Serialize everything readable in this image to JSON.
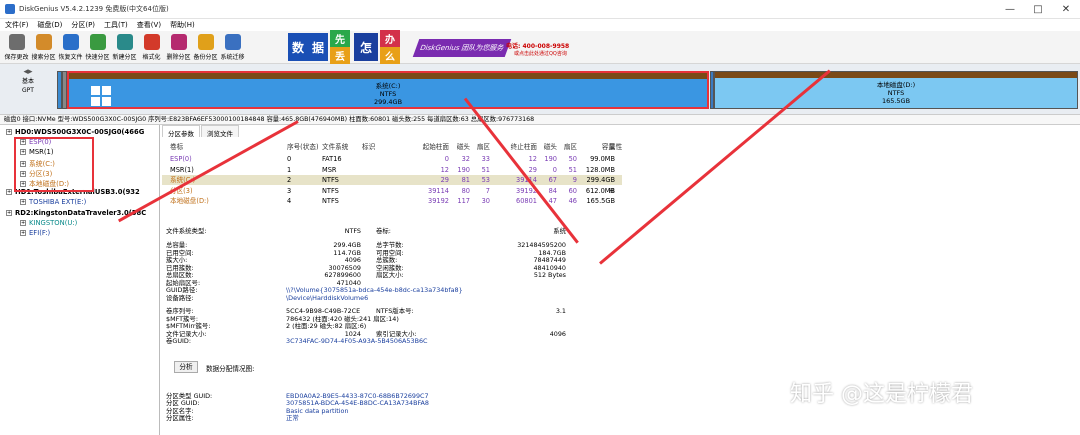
{
  "window": {
    "title": "DiskGenius V5.4.2.1239 免费版(中文64位版)",
    "controls": [
      "—",
      "□",
      "✕"
    ]
  },
  "menu": [
    "文件(F)",
    "磁盘(D)",
    "分区(P)",
    "工具(T)",
    "查看(V)",
    "帮助(H)"
  ],
  "toolbar": [
    {
      "label": "保存更改",
      "icon": "save-icon",
      "color": "#6d6d6d"
    },
    {
      "label": "搜索分区",
      "icon": "search-icon",
      "color": "#d38b2a"
    },
    {
      "label": "恢复文件",
      "icon": "recover-icon",
      "color": "#2a6fc9"
    },
    {
      "label": "快速分区",
      "icon": "quick-partition-icon",
      "color": "#3a9a40"
    },
    {
      "label": "新建分区",
      "icon": "new-partition-icon",
      "color": "#2a8a8a"
    },
    {
      "label": "格式化",
      "icon": "format-icon",
      "color": "#d33a2a"
    },
    {
      "label": "删除分区",
      "icon": "delete-icon",
      "color": "#b52a6f"
    },
    {
      "label": "备份分区",
      "icon": "backup-icon",
      "color": "#e0a01a"
    },
    {
      "label": "系统迁移",
      "icon": "migrate-icon",
      "color": "#3a70c0"
    }
  ],
  "banner": {
    "chars": [
      "数",
      "据",
      "先",
      "丢",
      "怎",
      "么",
      "办"
    ],
    "ribbon": "DiskGenius 团队为您服务",
    "phone": "电话: 400-008-9958",
    "qq": "或点击此处通过QQ咨询"
  },
  "disk_map": {
    "left_info": [
      "基本",
      "GPT"
    ],
    "system": {
      "name": "系统(C:)",
      "fs": "NTFS",
      "size": "299.4GB"
    },
    "local": {
      "name": "本地磁盘(D:)",
      "fs": "NTFS",
      "size": "165.5GB"
    }
  },
  "disk_info_line": "磁盘0 接口:NVMe  型号:WDS500G3X0C-00SJG0  序列号:E823BFA6EF53000100184848  容量:465.8GB(476940MB)  柱面数:60801  磁头数:255  每道扇区数:63  总扇区数:976773168",
  "tree": [
    {
      "label": "HD0:WDS500G3X0C-00SJG0(466G",
      "level": 0,
      "color": "#000"
    },
    {
      "label": "ESP(0)",
      "level": 1,
      "color": "#7a3db5"
    },
    {
      "label": "MSR(1)",
      "level": 1,
      "color": "#000"
    },
    {
      "label": "系统(C:)",
      "level": 1,
      "color": "#c0701a"
    },
    {
      "label": "分区(3)",
      "level": 1,
      "color": "#c0701a"
    },
    {
      "label": "本地磁盘(D:)",
      "level": 1,
      "color": "#c0701a"
    },
    {
      "label": "HD1:ToshibaExternalUSB3.0(932",
      "level": 0,
      "color": "#000"
    },
    {
      "label": "TOSHIBA EXT(E:)",
      "level": 1,
      "color": "#1a3f9e"
    },
    {
      "label": "RD2:KingstonDataTraveler3.0(58C",
      "level": 0,
      "color": "#000"
    },
    {
      "label": "KINGSTON(U:)",
      "level": 1,
      "color": "#0a8a8a"
    },
    {
      "label": "EFI(F:)",
      "level": 1,
      "color": "#1a3f9e"
    }
  ],
  "tabs": [
    "分区参数",
    "浏览文件"
  ],
  "partition_table": {
    "headers": [
      "卷标",
      "序号(状态)",
      "文件系统",
      "标识",
      "起始柱面",
      "磁头",
      "扇区",
      "终止柱面",
      "磁头",
      "扇区",
      "容量",
      "属性"
    ],
    "rows": [
      {
        "cells": [
          "ESP(0)",
          "0",
          "FAT16",
          "",
          "0",
          "32",
          "33",
          "12",
          "190",
          "50",
          "99.0MB",
          ""
        ],
        "color": "purple"
      },
      {
        "cells": [
          "MSR(1)",
          "1",
          "MSR",
          "",
          "12",
          "190",
          "51",
          "29",
          "0",
          "51",
          "128.0MB",
          ""
        ],
        "color": ""
      },
      {
        "cells": [
          "系统(C:)",
          "2",
          "NTFS",
          "",
          "29",
          "81",
          "53",
          "39114",
          "67",
          "9",
          "299.4GB",
          ""
        ],
        "color": "orange"
      },
      {
        "cells": [
          "分区(3)",
          "3",
          "NTFS",
          "",
          "39114",
          "80",
          "7",
          "39192",
          "84",
          "60",
          "612.0MB",
          "H"
        ],
        "color": "orange"
      },
      {
        "cells": [
          "本地磁盘(D:)",
          "4",
          "NTFS",
          "",
          "39192",
          "117",
          "30",
          "60801",
          "47",
          "46",
          "165.5GB",
          ""
        ],
        "color": "orange"
      }
    ]
  },
  "fs_info": {
    "fs_type_label": "文件系统类型:",
    "fs_type": "NTFS",
    "volume_label_label": "卷标:",
    "volume_label": "系统",
    "left": [
      [
        "总容量:",
        "299.4GB"
      ],
      [
        "已用空间:",
        "114.7GB"
      ],
      [
        "簇大小:",
        "4096"
      ],
      [
        "已用簇数:",
        "30076509"
      ],
      [
        "总扇区数:",
        "627899600"
      ],
      [
        "起始扇区号:",
        "471040"
      ]
    ],
    "right": [
      [
        "总字节数:",
        "321484595200"
      ],
      [
        "可用空间:",
        "184.7GB"
      ],
      [
        "总簇数:",
        "78487449"
      ],
      [
        "空闲簇数:",
        "48410940"
      ],
      [
        "扇区大小:",
        "512 Bytes"
      ]
    ],
    "guid_path_label": "GUID路径:",
    "guid_path": "\\\\?\\Volume{3075851a-bdca-454e-b8dc-ca13a734bfa8}",
    "device_path_label": "设备路径:",
    "device_path": "\\Device\\HarddiskVolume6",
    "serial_label": "卷序列号:",
    "serial": "5CC4-9B98-C49B-72CE",
    "ntfs_ver_label": "NTFS版本号:",
    "ntfs_ver": "3.1",
    "mft_label": "$MFT簇号:",
    "mft": "786432 (柱面:420 磁头:241 扇区:14)",
    "mftmirr_label": "$MFTMirr簇号:",
    "mftmirr": "2 (柱面:29 磁头:82 扇区:6)",
    "record_label": "文件记录大小:",
    "record": "1024",
    "index_label": "索引记录大小:",
    "index": "4096",
    "vguid_label": "卷GUID:",
    "vguid": "3C734FAC-9D74-4F05-A93A-5B4506A53B6C"
  },
  "analyze": {
    "button": "分析",
    "label": "数据分配情况图:"
  },
  "partition_guid": [
    [
      "分区类型 GUID:",
      "EBD0A0A2-B9E5-4433-87C0-68B6B72699C7"
    ],
    [
      "分区 GUID:",
      "3075851A-BDCA-454E-B8DC-CA13A734BFA8"
    ],
    [
      "分区名字:",
      "Basic data partition"
    ],
    [
      "分区属性:",
      "正常"
    ]
  ],
  "watermark": "知乎 @这是柠檬君"
}
